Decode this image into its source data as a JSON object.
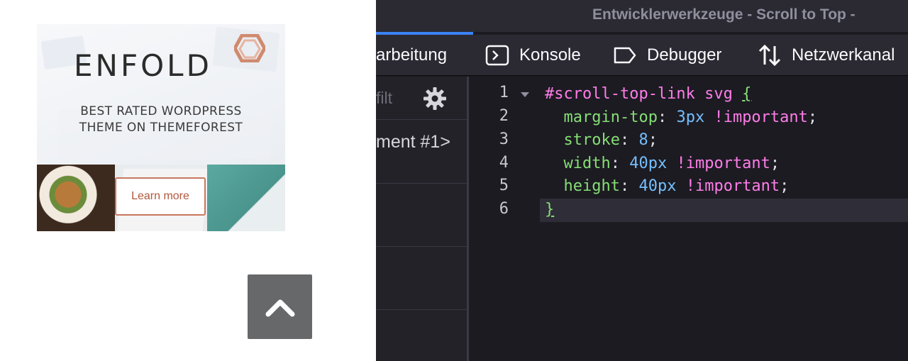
{
  "page": {
    "ad": {
      "logo_text": "ENFOLD",
      "tagline_1": "BEST RATED WORDPRESS",
      "tagline_2": "THEME ON THEMEFOREST",
      "button_label": "Learn more",
      "accent_color": "#c9785f"
    },
    "scroll_top_icon": "chevron-up-icon"
  },
  "devtools": {
    "window_title": "Entwicklerwerkzeuge - Scroll to Top -",
    "tabs": [
      {
        "label": "arbeitung",
        "icon": ""
      },
      {
        "label": "Konsole",
        "icon": "console-icon"
      },
      {
        "label": "Debugger",
        "icon": "debugger-icon"
      },
      {
        "label": "Netzwerkanal",
        "icon": "network-icon"
      }
    ],
    "sidebar": {
      "filter_placeholder": "filt",
      "item": "ment #1>"
    },
    "editor": {
      "line_numbers": [
        "1",
        "2",
        "3",
        "4",
        "5",
        "6"
      ],
      "lines": [
        {
          "selector": "#scroll-top-link svg",
          "brace": "{"
        },
        {
          "property": "margin-top",
          "value": "3px",
          "important": "!important"
        },
        {
          "property": "stroke",
          "value": "8"
        },
        {
          "property": "width",
          "value": "40px",
          "important": "!important"
        },
        {
          "property": "height",
          "value": "40px",
          "important": "!important"
        },
        {
          "brace": "}"
        }
      ]
    }
  }
}
